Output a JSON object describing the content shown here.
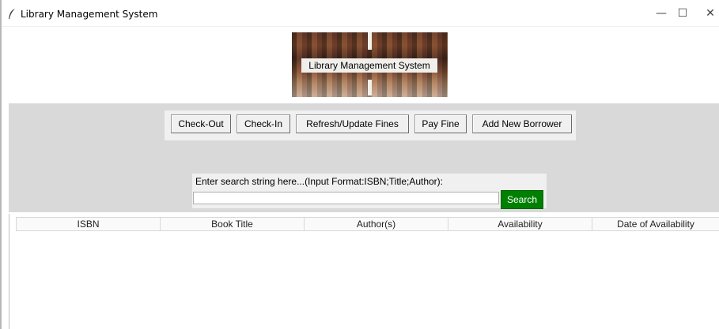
{
  "window": {
    "title": "Library Management System",
    "controls": {
      "minimize": "—",
      "maximize": "☐",
      "close": "✕"
    }
  },
  "banner": {
    "label": "Library Management System"
  },
  "toolbar": {
    "buttons": [
      {
        "label": "Check-Out"
      },
      {
        "label": "Check-In"
      },
      {
        "label": "Refresh/Update Fines"
      },
      {
        "label": "Pay Fine"
      },
      {
        "label": "Add New Borrower"
      }
    ]
  },
  "search": {
    "prompt": "Enter search string here...(Input Format:ISBN;Title;Author):",
    "value": "",
    "button_label": "Search",
    "button_color": "#008000"
  },
  "results": {
    "columns": [
      "ISBN",
      "Book Title",
      "Author(s)",
      "Availability",
      "Date of Availability"
    ],
    "rows": []
  }
}
